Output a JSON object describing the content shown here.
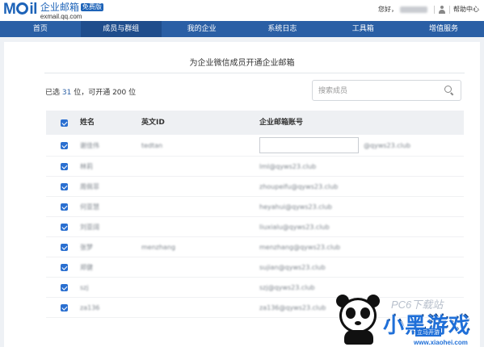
{
  "header": {
    "logo_mark": "M",
    "logo_mark_rest": "il",
    "logo_title": "企业邮箱",
    "logo_badge": "免费版",
    "logo_domain": "exmail.qq.com",
    "greeting": "您好，",
    "help_label": "帮助中心"
  },
  "nav": {
    "items": [
      "首页",
      "成员与群组",
      "我的企业",
      "系统日志",
      "工具箱",
      "增值服务"
    ],
    "active_index": 1
  },
  "panel": {
    "title": "为企业微信成员开通企业邮箱",
    "summary_prefix": "已选 ",
    "summary_count": "31",
    "summary_middle": " 位，可开通 ",
    "summary_limit": "200",
    "summary_suffix": " 位",
    "search_placeholder": "搜索成员"
  },
  "table": {
    "columns": {
      "name": "姓名",
      "english_id": "英文ID",
      "email": "企业邮箱账号"
    },
    "rows": [
      {
        "name": "谢佳伟",
        "english_id": "tedtan",
        "email": "",
        "domain": "@qyws23.club",
        "editing": true
      },
      {
        "name": "林莉",
        "english_id": "",
        "email": "lml@qyws23.club"
      },
      {
        "name": "周佩菲",
        "english_id": "",
        "email": "zhoupeifu@qyws23.club"
      },
      {
        "name": "何亚慧",
        "english_id": "",
        "email": "heyahui@qyws23.club"
      },
      {
        "name": "刘亚阔",
        "english_id": "",
        "email": "liuxialu@qyws23.club"
      },
      {
        "name": "张梦",
        "english_id": "menzhang",
        "email": "menzhang@qyws23.club"
      },
      {
        "name": "郑健",
        "english_id": "",
        "email": "sujian@qyws23.club"
      },
      {
        "name": "szj",
        "english_id": "",
        "email": "szj@qyws23.club"
      },
      {
        "name": "za136",
        "english_id": "",
        "email": "za136@qyws23.club"
      }
    ]
  },
  "watermark": {
    "site": "PC6下载站",
    "big_text": "小黑游戏",
    "sub_text": "立马开游",
    "url": "www.xiaohei.com"
  },
  "colors": {
    "nav_bg": "#2a5fa5",
    "nav_active": "#1f4d8c",
    "checkbox": "#2a6fd0",
    "brand": "#1d63b8"
  }
}
